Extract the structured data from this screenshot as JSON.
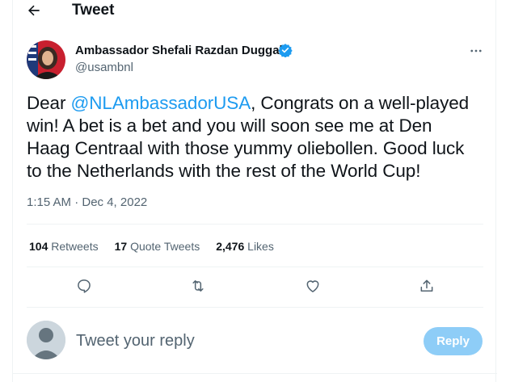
{
  "header": {
    "title": "Tweet",
    "back_icon": "arrow-left-icon"
  },
  "author": {
    "name": "Ambassador Shefali Razdan Duggal",
    "handle": "@usambnl",
    "verified": true,
    "verified_color": "#1d9bf0"
  },
  "tweet": {
    "line1_prefix": "Dear ",
    "mention": "@NLAmbassadorUSA",
    "line1_suffix": ", Congrats on a well-played",
    "line2": "win! A bet is a bet and you will soon see me at Den",
    "line3": "Haag Centraal with those yummy oliebollen. Good luck",
    "line4": "to the Netherlands with the rest of the World Cup!",
    "timestamp": "1:15 AM · Dec 4, 2022"
  },
  "stats": {
    "retweets_count": "104",
    "retweets_label": "Retweets",
    "quotes_count": "17",
    "quotes_label": "Quote Tweets",
    "likes_count": "2,476",
    "likes_label": "Likes"
  },
  "actions": [
    "reply-icon",
    "retweet-icon",
    "like-icon",
    "share-icon"
  ],
  "reply": {
    "placeholder": "Tweet your reply",
    "button_label": "Reply",
    "button_color": "#8ecdf7"
  },
  "colors": {
    "accent": "#1d9bf0",
    "text": "#0f1419",
    "secondary": "#536471",
    "divider": "#eff3f4"
  }
}
